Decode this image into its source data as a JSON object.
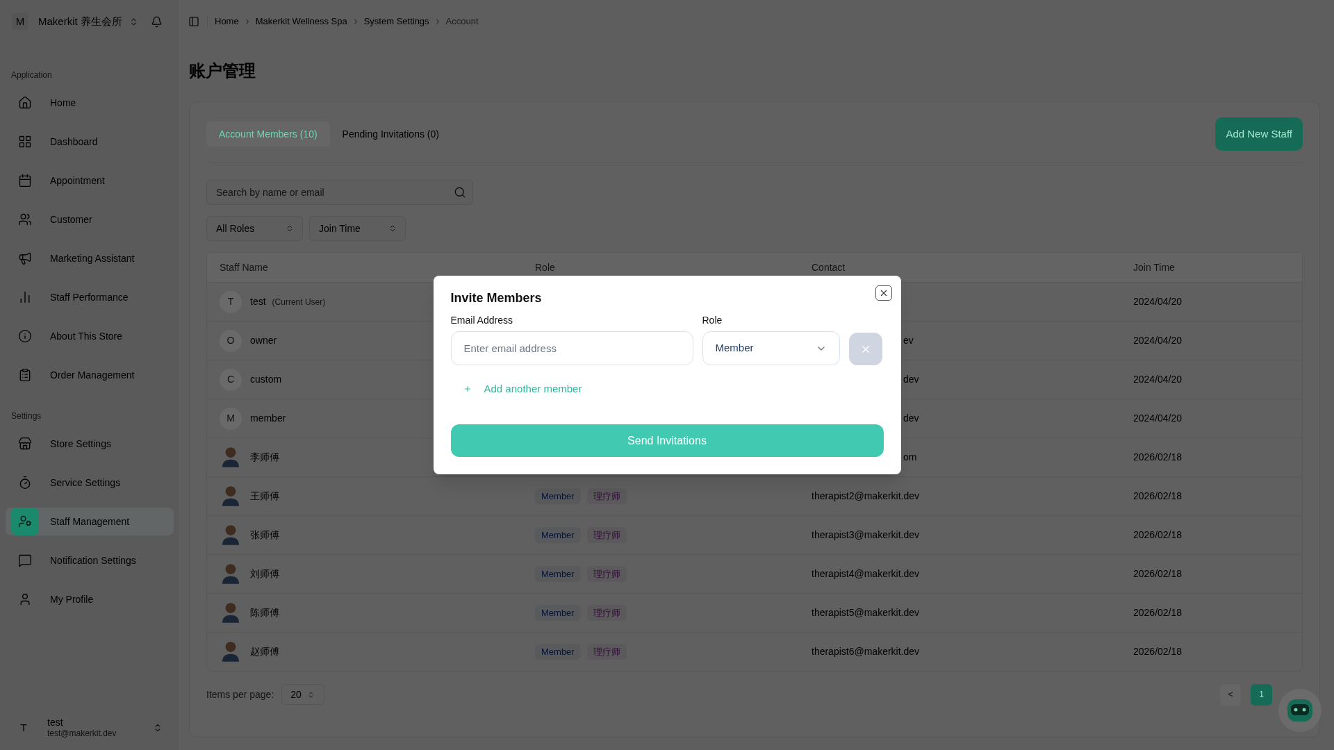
{
  "sidebar": {
    "team": {
      "initial": "M",
      "name": "Makerkit 养生会所"
    },
    "groups": [
      {
        "label": "Application",
        "items": [
          {
            "label": "Home",
            "selected": false
          },
          {
            "label": "Dashboard",
            "selected": false
          },
          {
            "label": "Appointment",
            "selected": false
          },
          {
            "label": "Customer",
            "selected": false
          },
          {
            "label": "Marketing Assistant",
            "selected": false
          },
          {
            "label": "Staff Performance",
            "selected": false
          },
          {
            "label": "About This Store",
            "selected": false
          },
          {
            "label": "Order Management",
            "selected": false
          }
        ]
      },
      {
        "label": "Settings",
        "items": [
          {
            "label": "Store Settings",
            "selected": false
          },
          {
            "label": "Service Settings",
            "selected": false
          },
          {
            "label": "Staff Management",
            "selected": true
          },
          {
            "label": "Notification Settings",
            "selected": false
          },
          {
            "label": "My Profile",
            "selected": false
          }
        ]
      }
    ],
    "user": {
      "initial": "T",
      "name": "test",
      "email": "test@makerkit.dev"
    }
  },
  "breadcrumb": [
    {
      "label": "Home",
      "current": false
    },
    {
      "label": "Makerkit Wellness Spa",
      "current": false
    },
    {
      "label": "System Settings",
      "current": false
    },
    {
      "label": "Account",
      "current": true
    }
  ],
  "page_title": "账户管理",
  "tabs": [
    {
      "label": "Account Members (10)",
      "selected": true
    },
    {
      "label": "Pending Invitations (0)",
      "selected": false
    }
  ],
  "add_button": "Add New Staff",
  "search": {
    "placeholder": "Search by name or email"
  },
  "filters": [
    {
      "value": "All Roles"
    },
    {
      "value": "Join Time"
    }
  ],
  "table": {
    "columns": [
      "Staff Name",
      "Role",
      "Contact",
      "Join Time"
    ],
    "rows": [
      {
        "avatar": {
          "kind": "initial",
          "initial": "T"
        },
        "name": "test",
        "tag": "(Current User)",
        "join_time": "2024/04/20"
      },
      {
        "avatar": {
          "kind": "initial",
          "initial": "O"
        },
        "name": "owner",
        "contact": "ev",
        "contact_partly_hidden": true,
        "join_time": "2024/04/20"
      },
      {
        "avatar": {
          "kind": "initial",
          "initial": "C"
        },
        "name": "custom",
        "contact": "dev",
        "contact_partly_hidden": true,
        "join_time": "2024/04/20"
      },
      {
        "avatar": {
          "kind": "initial",
          "initial": "M"
        },
        "name": "member",
        "contact": "dev",
        "contact_partly_hidden": true,
        "join_time": "2024/04/20"
      },
      {
        "avatar": {
          "kind": "illustration"
        },
        "name": "李师傅",
        "contact": "om",
        "contact_partly_hidden": true,
        "join_time": "2026/02/18"
      },
      {
        "avatar": {
          "kind": "illustration"
        },
        "name": "王师傅",
        "roles": [
          {
            "label": "Member",
            "color": "#071436"
          },
          {
            "label": "理疗师",
            "color": "#33083a"
          }
        ],
        "contact": "therapist2@makerkit.dev",
        "join_time": "2026/02/18"
      },
      {
        "avatar": {
          "kind": "illustration"
        },
        "name": "张师傅",
        "roles": [
          {
            "label": "Member",
            "color": "#071436"
          },
          {
            "label": "理疗师",
            "color": "#33083a"
          }
        ],
        "contact": "therapist3@makerkit.dev",
        "join_time": "2026/02/18"
      },
      {
        "avatar": {
          "kind": "illustration"
        },
        "name": "刘师傅",
        "roles": [
          {
            "label": "Member",
            "color": "#071436"
          },
          {
            "label": "理疗师",
            "color": "#33083a"
          }
        ],
        "contact": "therapist4@makerkit.dev",
        "join_time": "2026/02/18"
      },
      {
        "avatar": {
          "kind": "illustration"
        },
        "name": "陈师傅",
        "roles": [
          {
            "label": "Member",
            "color": "#071436"
          },
          {
            "label": "理疗师",
            "color": "#33083a"
          }
        ],
        "contact": "therapist5@makerkit.dev",
        "join_time": "2026/02/18"
      },
      {
        "avatar": {
          "kind": "illustration"
        },
        "name": "赵师傅",
        "roles": [
          {
            "label": "Member",
            "color": "#071436"
          },
          {
            "label": "理疗师",
            "color": "#33083a"
          }
        ],
        "contact": "therapist6@makerkit.dev",
        "join_time": "2026/02/18"
      }
    ]
  },
  "pagination": {
    "label": "Items per page:",
    "page_size": "20",
    "prev": "<",
    "pages": [
      {
        "label": "1",
        "selected": true
      }
    ]
  },
  "modal": {
    "title": "Invite Members",
    "email": {
      "label": "Email Address",
      "placeholder": "Enter email address"
    },
    "role": {
      "label": "Role",
      "value": "Member"
    },
    "add_another": "Add another member",
    "submit": "Send Invitations"
  }
}
